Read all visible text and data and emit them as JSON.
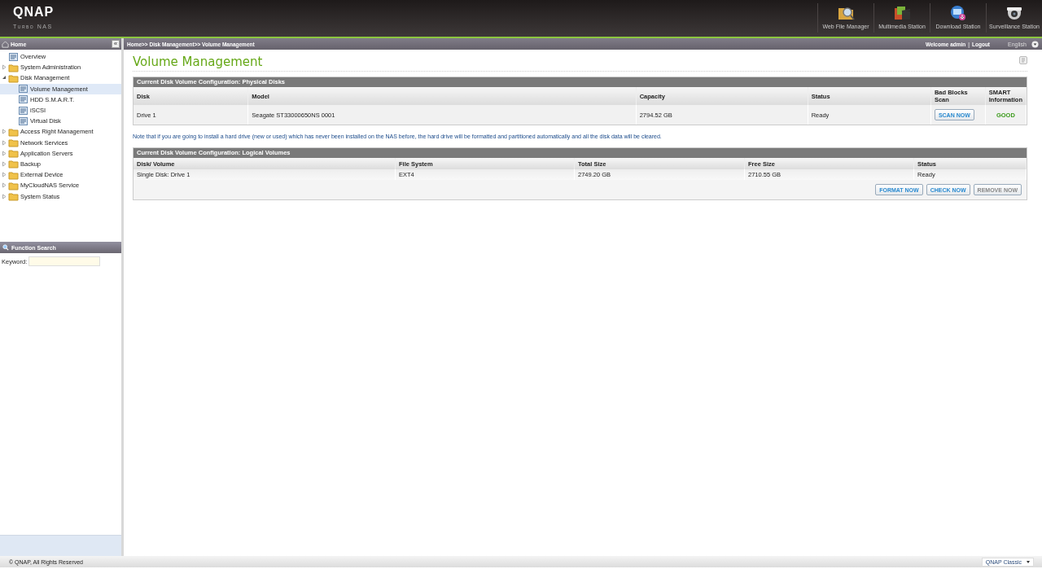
{
  "header": {
    "logo": "QNAP",
    "subtitle": "Turbo NAS",
    "apps": [
      {
        "label": "Web File Manager",
        "kind": "files"
      },
      {
        "label": "Multimedia Station",
        "kind": "media"
      },
      {
        "label": "Download Station",
        "kind": "download"
      },
      {
        "label": "Surveillance Station",
        "kind": "camera"
      }
    ]
  },
  "sidebar": {
    "title": "Home",
    "collapse": "«",
    "items": [
      {
        "label": "Overview",
        "kind": "page",
        "selected": false
      },
      {
        "label": "System Administration",
        "kind": "folder",
        "expanded": false,
        "selected": false
      },
      {
        "label": "Disk Management",
        "kind": "folder",
        "expanded": true,
        "selected": false,
        "children": [
          {
            "label": "Volume Management",
            "kind": "page",
            "selected": true
          },
          {
            "label": "HDD S.M.A.R.T.",
            "kind": "page",
            "selected": false
          },
          {
            "label": "iSCSI",
            "kind": "page",
            "selected": false
          },
          {
            "label": "Virtual Disk",
            "kind": "page",
            "selected": false
          }
        ]
      },
      {
        "label": "Access Right Management",
        "kind": "folder",
        "expanded": false,
        "selected": false
      },
      {
        "label": "Network Services",
        "kind": "folder",
        "expanded": false,
        "selected": false
      },
      {
        "label": "Application Servers",
        "kind": "folder",
        "expanded": false,
        "selected": false
      },
      {
        "label": "Backup",
        "kind": "folder",
        "expanded": false,
        "selected": false
      },
      {
        "label": "External Device",
        "kind": "folder",
        "expanded": false,
        "selected": false
      },
      {
        "label": "MyCloudNAS Service",
        "kind": "folder",
        "expanded": false,
        "selected": false
      },
      {
        "label": "System Status",
        "kind": "folder",
        "expanded": false,
        "selected": false
      }
    ],
    "search": {
      "title": "Function Search",
      "label": "Keyword:"
    }
  },
  "breadcrumb": "Home>> Disk Management>> Volume Management",
  "welcome": {
    "text": "Welcome admin",
    "separator": "|",
    "logout": "Logout",
    "language": "English"
  },
  "page_title": "Volume Management",
  "physical": {
    "title": "Current Disk Volume Configuration: Physical Disks",
    "columns": [
      "Disk",
      "Model",
      "Capacity",
      "Status",
      "Bad Blocks Scan",
      "SMART Information"
    ],
    "rows": [
      [
        {
          "kind": "text",
          "text": "Drive 1"
        },
        {
          "kind": "text",
          "text": "Seagate ST33000650NS 0001"
        },
        {
          "kind": "text",
          "text": "2794.52 GB"
        },
        {
          "kind": "text",
          "text": "Ready"
        },
        {
          "kind": "button",
          "text": "SCAN NOW"
        },
        {
          "kind": "good",
          "text": "GOOD"
        }
      ]
    ]
  },
  "note": "Note that if you are going to install a hard drive (new or used) which has never been installed on the NAS before, the hard drive will be formatted and partitioned automatically and all the disk data will be cleared.",
  "logical": {
    "title": "Current Disk Volume Configuration: Logical Volumes",
    "columns": [
      "Disk/ Volume",
      "File System",
      "Total Size",
      "Free Size",
      "Status"
    ],
    "rows": [
      [
        "Single Disk: Drive 1",
        "EXT4",
        "2749.20 GB",
        "2710.55 GB",
        "Ready"
      ]
    ],
    "buttons": [
      {
        "label": "FORMAT NOW",
        "disabled": false
      },
      {
        "label": "CHECK NOW",
        "disabled": false
      },
      {
        "label": "REMOVE NOW",
        "disabled": true
      }
    ]
  },
  "footer": {
    "copyright": "© QNAP, All Rights Reserved",
    "theme": "QNAP Classic"
  }
}
